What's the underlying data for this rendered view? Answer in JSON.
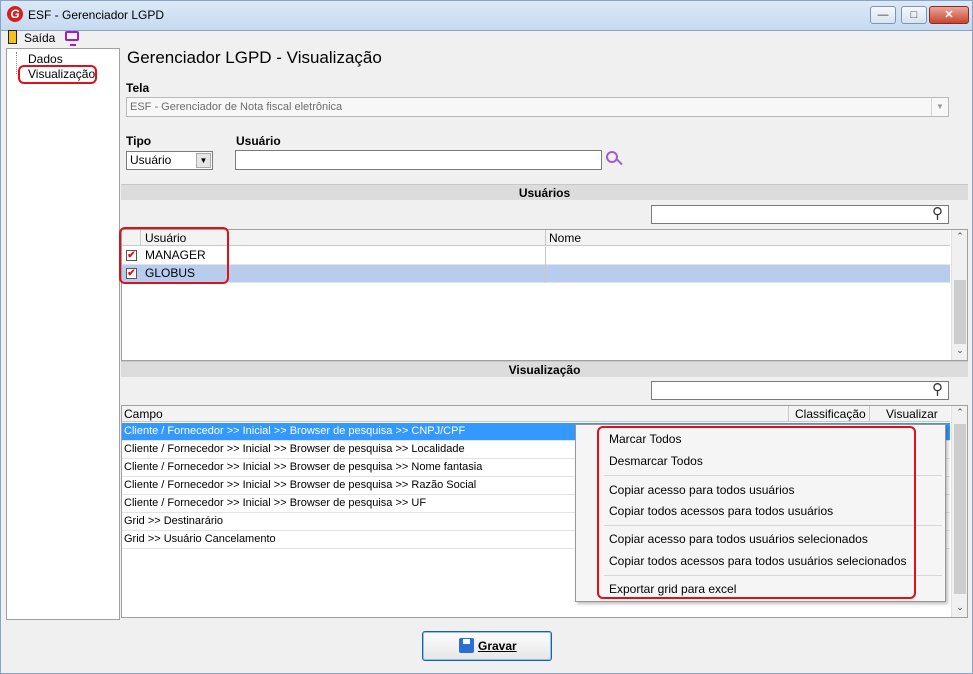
{
  "window": {
    "title": "ESF - Gerenciador LGPD",
    "logo_letter": "G"
  },
  "menu": {
    "saida_label": "Saída",
    "monitor_icon": "monitor-icon"
  },
  "tree": {
    "items": [
      {
        "label": "Dados"
      },
      {
        "label": "Visualização",
        "highlighted": true
      }
    ]
  },
  "page": {
    "title": "Gerenciador LGPD - Visualização"
  },
  "tela": {
    "label": "Tela",
    "value": "ESF - Gerenciador de Nota fiscal eletrônica"
  },
  "tipo": {
    "label": "Tipo",
    "value": "Usuário"
  },
  "usuario": {
    "label": "Usuário",
    "value": ""
  },
  "usuarios_section": {
    "title": "Usuários",
    "search_value": "",
    "columns": [
      "Usuário",
      "Nome"
    ],
    "rows": [
      {
        "usuario": "MANAGER",
        "nome": "",
        "checked": true
      },
      {
        "usuario": "GLOBUS",
        "nome": "",
        "checked": true,
        "selected": true
      }
    ]
  },
  "visualizacao_section": {
    "title": "Visualização",
    "search_value": "",
    "columns": [
      "Campo",
      "Classificação",
      "Visualizar"
    ],
    "rows": [
      "Cliente / Fornecedor >> Inicial >> Browser de pesquisa >> CNPJ/CPF",
      "Cliente / Fornecedor >> Inicial >> Browser de pesquisa >> Localidade",
      "Cliente / Fornecedor >> Inicial >> Browser de pesquisa >> Nome fantasia",
      "Cliente / Fornecedor >> Inicial >> Browser de pesquisa >> Razão Social",
      "Cliente / Fornecedor >> Inicial >> Browser de pesquisa >> UF",
      "Grid >> Destinarário",
      "Grid >> Usuário Cancelamento"
    ]
  },
  "context_menu": {
    "items": [
      "Marcar Todos",
      "Desmarcar Todos",
      "Copiar acesso para todos usuários",
      "Copiar todos acessos para todos usuários",
      "Copiar acesso para todos usuários selecionados",
      "Copiar todos acessos para todos usuários selecionados",
      "Exportar grid para excel"
    ]
  },
  "footer": {
    "gravar_label": "Gravar"
  },
  "colors": {
    "highlight_red": "#e0101a",
    "selection_blue": "#3399ff",
    "selected_row": "#b8cdee"
  }
}
